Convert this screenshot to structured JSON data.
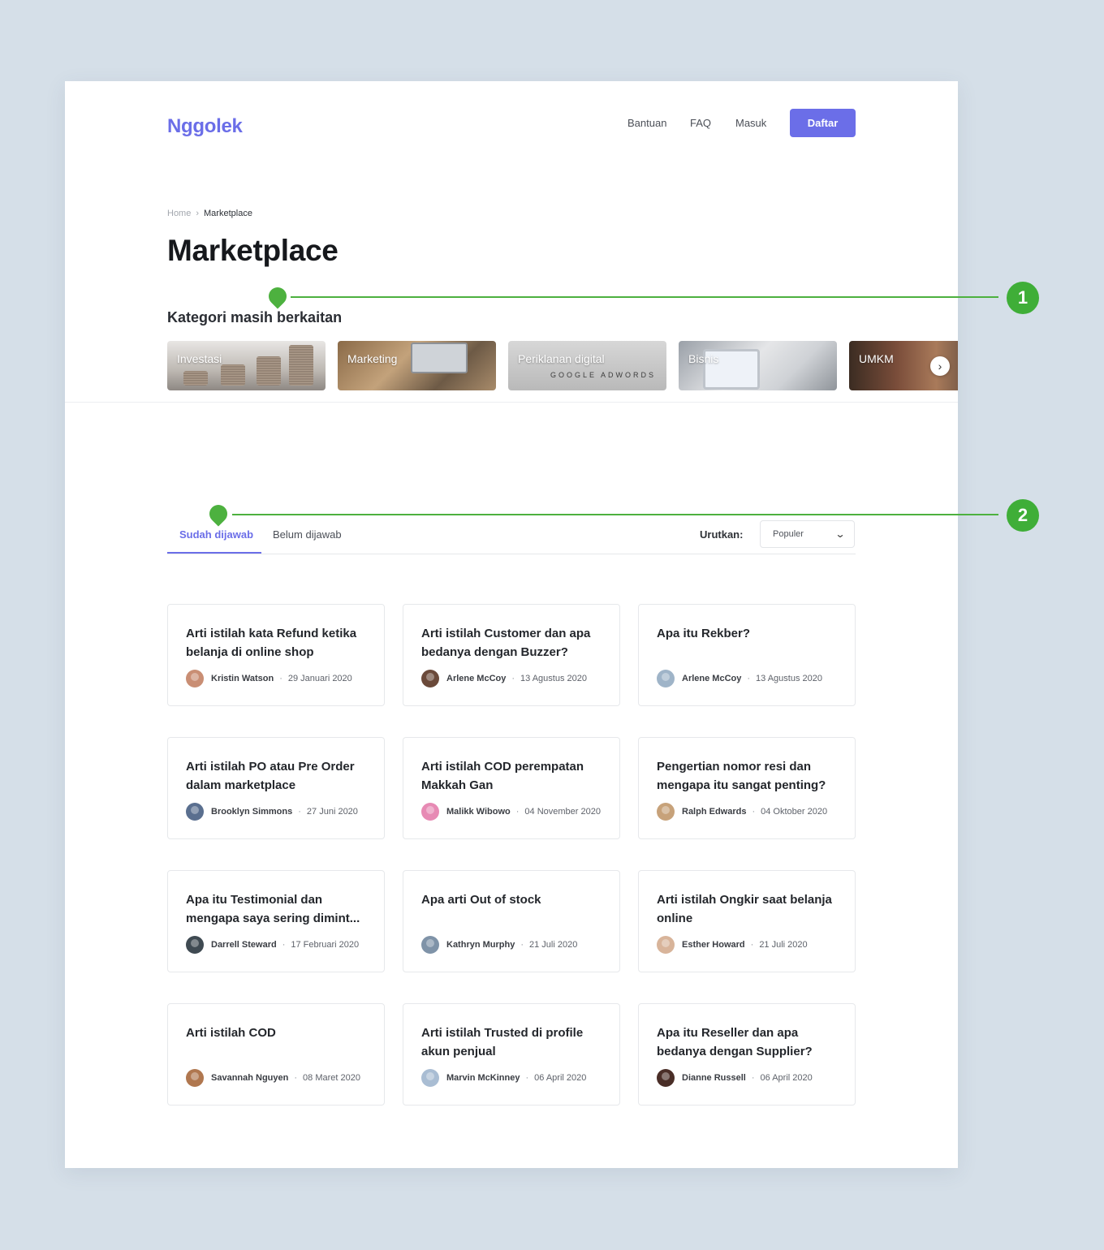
{
  "header": {
    "logo": "Nggolek",
    "nav": [
      "Bantuan",
      "FAQ",
      "Masuk"
    ],
    "cta": "Daftar"
  },
  "breadcrumb": {
    "home": "Home",
    "separator": "›",
    "current": "Marketplace"
  },
  "page_title": "Marketplace",
  "categories": {
    "title": "Kategori masih berkaitan",
    "items": [
      "Investasi",
      "Marketing",
      "Periklanan digital",
      "Bisnis",
      "UMKM"
    ],
    "adwords_text": "GOOGLE ADWORDS"
  },
  "tabs": {
    "answered": "Sudah dijawab",
    "unanswered": "Belum dijawab"
  },
  "sort": {
    "label": "Urutkan:",
    "value": "Populer"
  },
  "questions": [
    {
      "title": "Arti istilah kata Refund ketika belanja di online shop",
      "author": "Kristin Watson",
      "date": "29 Januari 2020",
      "avatar_color": "#c98e74"
    },
    {
      "title": "Arti istilah Customer dan apa bedanya dengan Buzzer?",
      "author": "Arlene McCoy",
      "date": "13 Agustus 2020",
      "avatar_color": "#6b4a3a"
    },
    {
      "title": "Apa itu Rekber?",
      "author": "Arlene McCoy",
      "date": "13 Agustus 2020",
      "avatar_color": "#9fb4c8"
    },
    {
      "title": "Arti istilah PO atau Pre Order dalam marketplace",
      "author": "Brooklyn Simmons",
      "date": "27 Juni 2020",
      "avatar_color": "#5a6f8f"
    },
    {
      "title": "Arti istilah COD perempatan Makkah Gan",
      "author": "Malikk Wibowo",
      "date": "04 November 2020",
      "avatar_color": "#e78ab4"
    },
    {
      "title": "Pengertian nomor resi dan mengapa itu sangat penting?",
      "author": "Ralph Edwards",
      "date": "04 Oktober 2020",
      "avatar_color": "#c7a27a"
    },
    {
      "title": "Apa itu Testimonial dan mengapa saya sering dimint...",
      "author": "Darrell Steward",
      "date": "17 Februari 2020",
      "avatar_color": "#3f4a52"
    },
    {
      "title": "Apa arti Out of stock",
      "author": "Kathryn Murphy",
      "date": "21 Juli 2020",
      "avatar_color": "#7f93a8"
    },
    {
      "title": "Arti istilah Ongkir saat belanja online",
      "author": "Esther Howard",
      "date": "21 Juli 2020",
      "avatar_color": "#d8b49a"
    },
    {
      "title": "Arti istilah COD",
      "author": "Savannah Nguyen",
      "date": "08 Maret 2020",
      "avatar_color": "#b0774f"
    },
    {
      "title": "Arti istilah Trusted di profile akun penjual",
      "author": "Marvin McKinney",
      "date": "06 April 2020",
      "avatar_color": "#a9bdd3"
    },
    {
      "title": "Apa itu Reseller dan apa bedanya dengan Supplier?",
      "author": "Dianne Russell",
      "date": "06 April 2020",
      "avatar_color": "#4a2e27"
    }
  ],
  "annotations": [
    "1",
    "2"
  ],
  "colors": {
    "accent": "#6b6ee8",
    "annotation": "#4db13f",
    "background": "#d5dfe8"
  }
}
